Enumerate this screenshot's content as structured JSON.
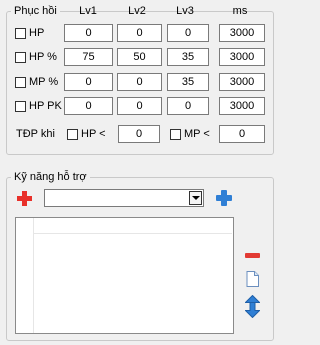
{
  "recovery": {
    "title": "Phục hồi",
    "headers": [
      "Lv1",
      "Lv2",
      "Lv3",
      "ms"
    ],
    "rows": [
      {
        "label": "HP",
        "checked": false,
        "values": [
          "0",
          "0",
          "0",
          "3000"
        ]
      },
      {
        "label": "HP %",
        "checked": false,
        "values": [
          "75",
          "50",
          "35",
          "3000"
        ]
      },
      {
        "label": "MP %",
        "checked": false,
        "values": [
          "0",
          "0",
          "35",
          "3000"
        ]
      },
      {
        "label": "HP PK",
        "checked": false,
        "values": [
          "0",
          "0",
          "0",
          "3000"
        ]
      }
    ],
    "tdp": {
      "label": "TĐP khi",
      "hp_label": "HP <",
      "hp_value": "0",
      "mp_label": "MP <",
      "mp_value": "0"
    }
  },
  "skills": {
    "title": "Kỹ năng hỗ trợ",
    "selected": "",
    "icons": {
      "add_row": "red-plus-icon",
      "add_skill": "blue-plus-icon",
      "remove": "red-minus-icon",
      "new": "new-document-icon",
      "up": "blue-arrow-up-icon",
      "down": "blue-arrow-down-icon"
    }
  },
  "colors": {
    "red": "#e8302a",
    "blue": "#2f7fd5"
  }
}
